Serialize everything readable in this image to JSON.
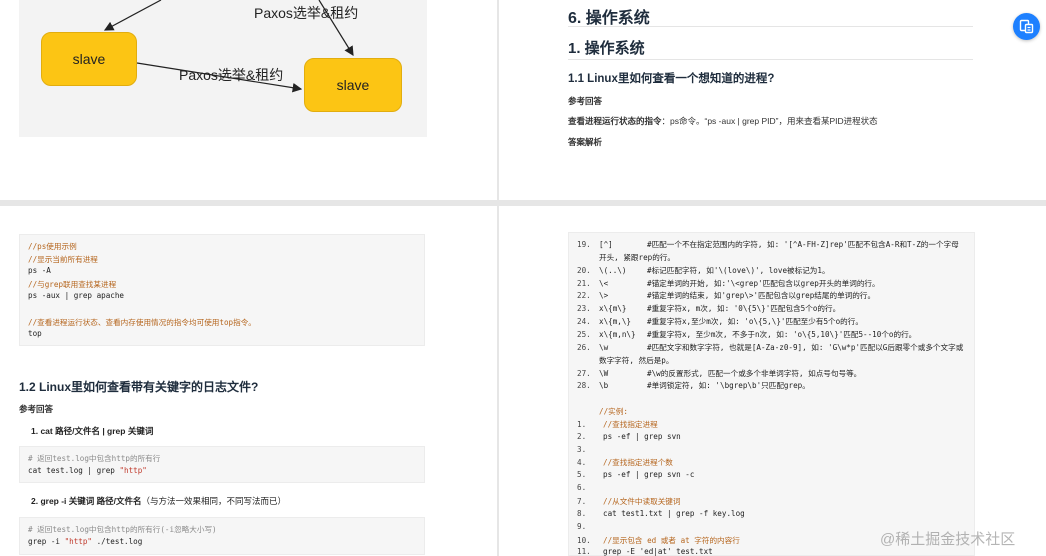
{
  "diagram": {
    "node_left": "slave",
    "node_right": "slave",
    "edge_label_top": "Paxos选举&租约",
    "edge_label_mid": "Paxos选举&租约"
  },
  "page_tr": {
    "section_heading": "6. 操作系统",
    "chapter_heading": "1. 操作系统",
    "q_heading": "1.1 Linux里如何查看一个想知道的进程?",
    "ref_label": "参考回答",
    "answer_bold": "查看进程运行状态的指令",
    "answer_rest": "：ps命令。“ps -aux | grep PID”，用来查看某PID进程状态",
    "analysis_label": "答案解析"
  },
  "code_ps": [
    {
      "t": "//ps使用示例",
      "c": "cm"
    },
    {
      "t": "//显示当前所有进程",
      "c": "cm"
    },
    {
      "t": "ps -A",
      "c": ""
    },
    {
      "t": "//与grep联用查找某进程",
      "c": "cm"
    },
    {
      "t": "ps -aux | grep apache",
      "c": ""
    },
    {
      "t": "",
      "c": ""
    },
    {
      "t": "//查看进程运行状态、查看内存使用情况的指令均可使用top指令。",
      "c": "cm"
    },
    {
      "t": "top",
      "c": ""
    }
  ],
  "page_bl": {
    "q_heading": "1.2 Linux里如何查看带有关键字的日志文件?",
    "ref_label": "参考回答",
    "item1": "1. cat 路径/文件名 | grep 关键词",
    "code1_comment": "# 返回test.log中包含http的所有行",
    "code1_cmd": "cat test.log | grep ",
    "code1_str": "\"http\"",
    "item2_bold": "2. grep -i 关键词 路径/文件名",
    "item2_rest": "（与方法一效果相同，不同写法而已）",
    "code2_comment": "# 返回test.log中包含http的所有行(-i忽略大小写)",
    "code2_cmd": "grep -i ",
    "code2_str": "\"http\"",
    "code2_tail": " ./test.log"
  },
  "code_regex": [
    {
      "n": "19.",
      "a": "[^]",
      "b": "#匹配一个不在指定范围内的字符, 如: '[^A-FH-Z]rep'匹配不包含A-R和T-Z的一个字母"
    },
    {
      "n": "",
      "a": "",
      "b": "开头, 紧跟rep的行。"
    },
    {
      "n": "20.",
      "a": "\\(..\\)",
      "b": "#标记匹配字符, 如'\\(love\\)', love被标记为1。"
    },
    {
      "n": "21.",
      "a": "\\<",
      "b": "#锚定单词的开始, 如:'\\<grep'匹配包含以grep开头的单词的行。"
    },
    {
      "n": "22.",
      "a": "\\>",
      "b": "#锚定单词的结束, 如'grep\\>'匹配包含以grep结尾的单词的行。"
    },
    {
      "n": "23.",
      "a": "x\\{m\\}",
      "b": "#重复字符x, m次, 如: '0\\{5\\}'匹配包含5个o的行。"
    },
    {
      "n": "24.",
      "a": "x\\{m,\\}",
      "b": "#重复字符x,至少m次, 如: 'o\\{5,\\}'匹配至少有5个o的行。"
    },
    {
      "n": "25.",
      "a": "x\\{m,n\\}",
      "b": "#重复字符x, 至少m次, 不多于n次, 如: 'o\\{5,10\\}'匹配5--10个o的行。"
    },
    {
      "n": "26.",
      "a": "\\w",
      "b": "#匹配文字和数字字符, 也就是[A-Za-z0-9], 如: 'G\\w*p'匹配以G后跟零个或多个文字或"
    },
    {
      "n": "",
      "a": "",
      "b": "数字字符, 然后是p。"
    },
    {
      "n": "27.",
      "a": "\\W",
      "b": "#\\w的反置形式, 匹配一个或多个非单词字符, 如点号句号等。"
    },
    {
      "n": "28.",
      "a": "\\b",
      "b": "#单词锁定符, 如: '\\bgrep\\b'只匹配grep。"
    },
    {
      "n": "",
      "a": "",
      "b": ""
    },
    {
      "n": "",
      "a": "",
      "b": "//实例:"
    },
    {
      "n": "1.",
      "a": "",
      "b": "//查找指定进程"
    },
    {
      "n": "2.",
      "a": "",
      "b": "ps -ef | grep svn"
    },
    {
      "n": "3.",
      "a": "",
      "b": ""
    },
    {
      "n": "4.",
      "a": "",
      "b": "//查找指定进程个数"
    },
    {
      "n": "5.",
      "a": "",
      "b": "ps -ef | grep svn -c"
    },
    {
      "n": "6.",
      "a": "",
      "b": ""
    },
    {
      "n": "7.",
      "a": "",
      "b": "//从文件中读取关键词"
    },
    {
      "n": "8.",
      "a": "",
      "b": "cat test1.txt | grep -f key.log"
    },
    {
      "n": "9.",
      "a": "",
      "b": ""
    },
    {
      "n": "10.",
      "a": "",
      "b": "//显示包含 ed 或者 at 字符的内容行"
    },
    {
      "n": "11.",
      "a": "",
      "b": "grep -E 'ed|at' test.txt"
    }
  ],
  "overlay": {
    "watermark": "@稀土掘金技术社区",
    "float_icon": "document-translate-icon"
  }
}
